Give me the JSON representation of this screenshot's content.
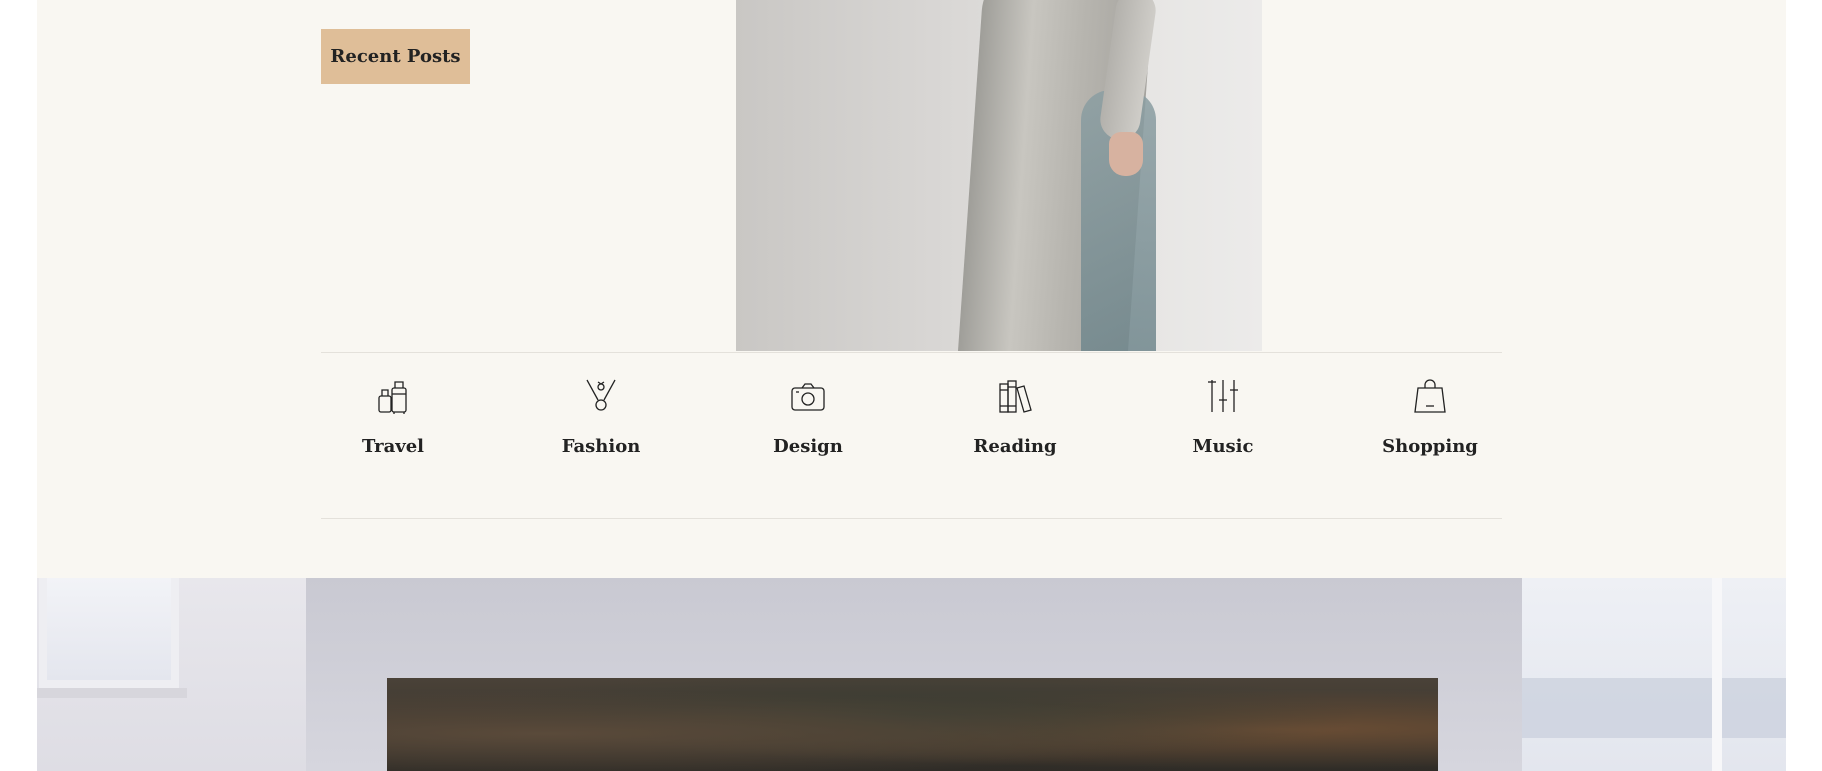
{
  "sidebar": {
    "recent_posts_label": "Recent Posts"
  },
  "categories": [
    {
      "label": "Travel",
      "icon": "luggage-icon"
    },
    {
      "label": "Fashion",
      "icon": "necklace-icon"
    },
    {
      "label": "Design",
      "icon": "camera-icon"
    },
    {
      "label": "Reading",
      "icon": "books-icon"
    },
    {
      "label": "Music",
      "icon": "equalizer-icon"
    },
    {
      "label": "Shopping",
      "icon": "shopping-bag-icon"
    }
  ],
  "colors": {
    "panel_background": "#f9f7f2",
    "button_accent": "#dfbe98",
    "text": "#222222",
    "divider": "#e4e1db"
  }
}
